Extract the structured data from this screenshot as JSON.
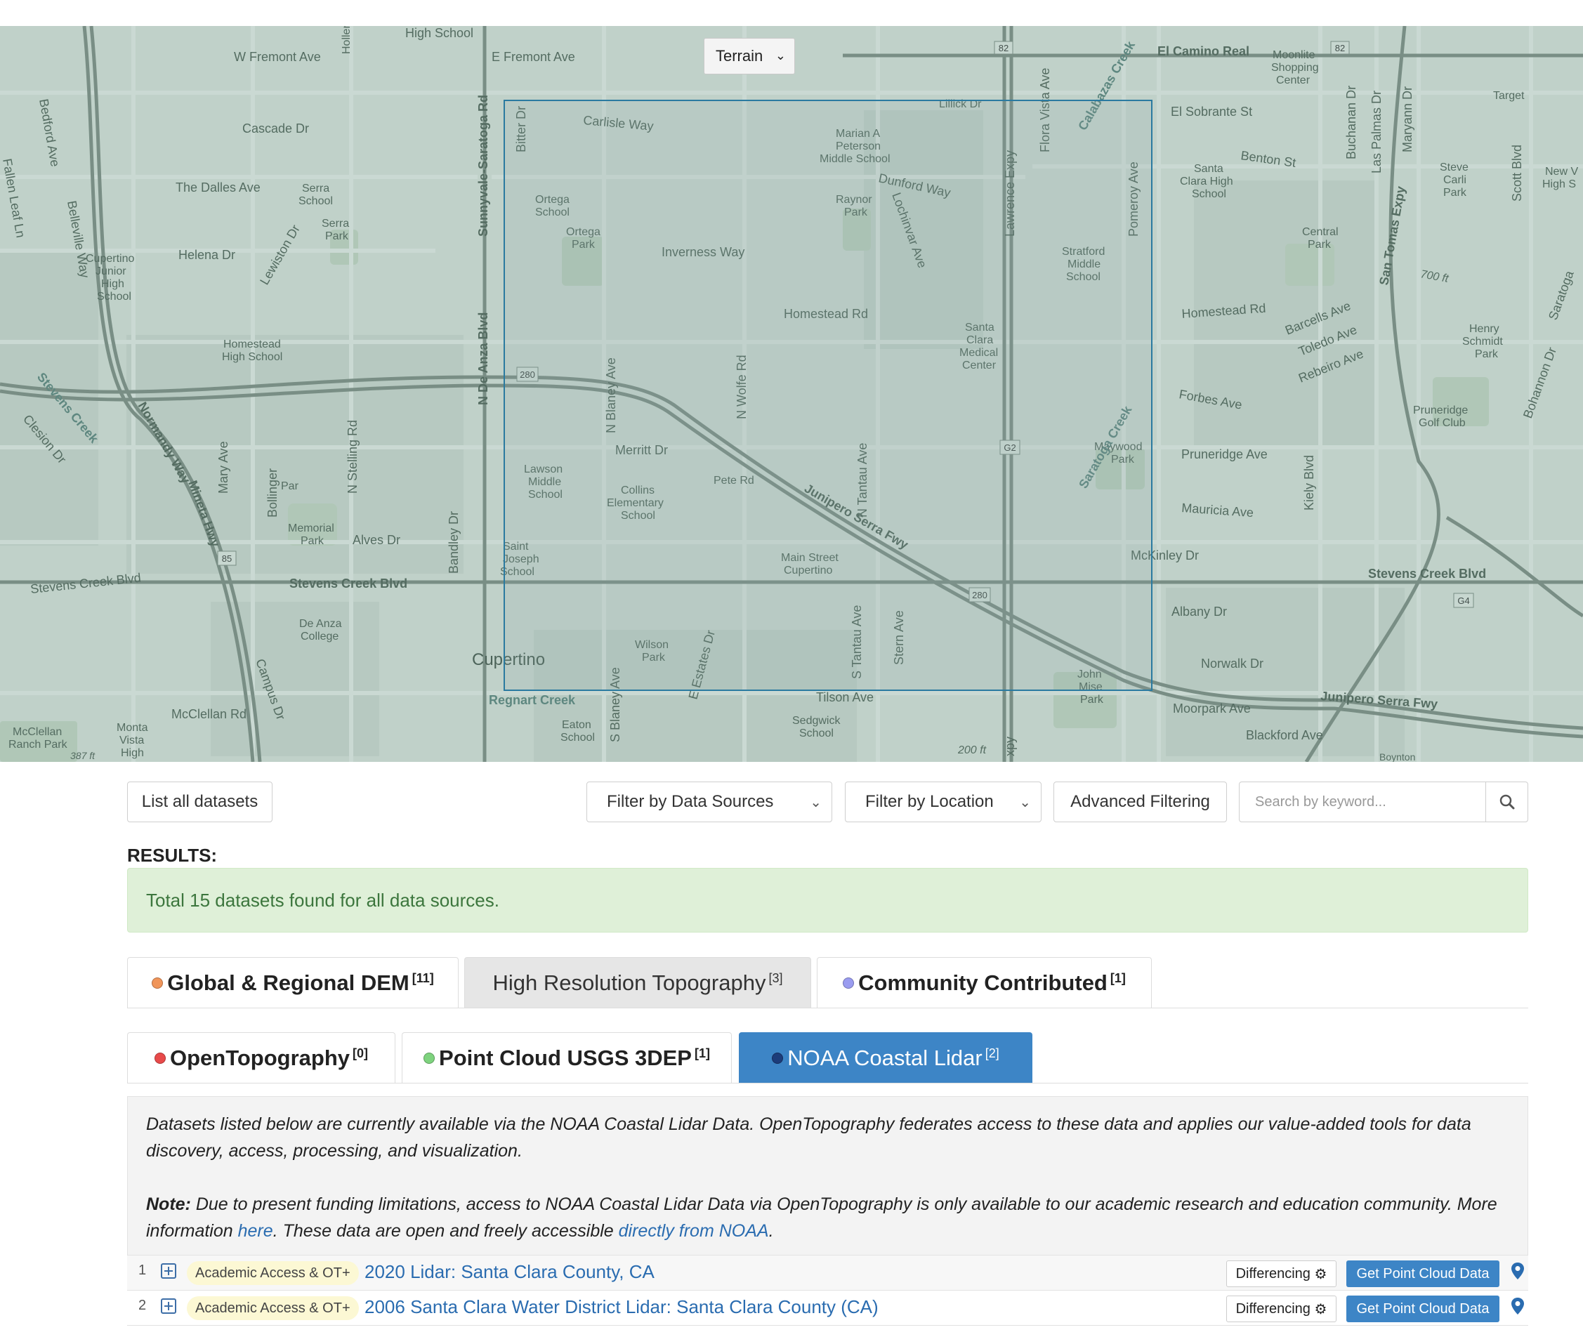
{
  "map": {
    "terrain_select": "Terrain",
    "labels": {
      "w_fremont": "W Fremont Ave",
      "high_school": "High School",
      "e_fremont": "E Fremont Ave",
      "el_camino": "El Camino Real",
      "moonlite": "Moonlite",
      "shopping": "Shopping",
      "center": "Center",
      "target": "Target",
      "cascade": "Cascade Dr",
      "carlisle": "Carlisle Way",
      "marian": "Marian A",
      "peterson": "Peterson",
      "middle_school": "Middle School",
      "el_sobrante": "El Sobrante St",
      "benton": "Benton St",
      "the_dalles": "The Dalles Ave",
      "serra_school": "Serra",
      "serra_school2": "School",
      "serra_park": "Serra",
      "serra_park2": "Park",
      "ortega_school": "Ortega",
      "ortega_school2": "School",
      "ortega_park": "Ortega",
      "ortega_park2": "Park",
      "dunford": "Dunford Way",
      "raynor": "Raynor",
      "raynor2": "Park",
      "santa_clara_hs": "Santa",
      "santa_clara_hs2": "Clara High",
      "santa_clara_hs3": "School",
      "steve_carli": "Steve",
      "steve_carli2": "Carli",
      "steve_carli3": "Park",
      "new_v": "New V",
      "high_s": "High S",
      "helena": "Helena Dr",
      "inverness": "Inverness Way",
      "stratford": "Stratford",
      "stratford2": "Middle",
      "stratford3": "School",
      "central_park": "Central",
      "central_park2": "Park",
      "cupertino_jr": "Cupertino",
      "cupertino_jr2": "Junior",
      "cupertino_jr3": "High",
      "cupertino_jr4": "School",
      "homestead_rd": "Homestead Rd",
      "homestead_rd2": "Homestead Rd",
      "homestead_hs": "Homestead",
      "homestead_hs2": "High School",
      "santa_clara_mc": "Santa",
      "santa_clara_mc2": "Clara",
      "santa_clara_mc3": "Medical",
      "santa_clara_mc4": "Center",
      "barcells": "Barcells Ave",
      "toledo": "Toledo Ave",
      "rebeiro": "Rebeiro Ave",
      "henry": "Henry",
      "henry2": "Schmidt",
      "henry3": "Park",
      "forbes": "Forbes Ave",
      "pruneridge_gc": "Pruneridge",
      "pruneridge_gc2": "Golf Club",
      "merritt": "Merritt Dr",
      "pruneridge_ave": "Pruneridge Ave",
      "lawson": "Lawson",
      "lawson2": "Middle",
      "lawson3": "School",
      "collins": "Collins",
      "collins2": "Elementary",
      "collins3": "School",
      "maywood": "Maywood",
      "maywood2": "Park",
      "mauricia": "Mauricia Ave",
      "memorial": "Memorial",
      "memorial2": "Park",
      "alves": "Alves Dr",
      "junipero": "Junipero Serra Fwy",
      "mckinley": "McKinley Dr",
      "stevens_creek_blvd": "Stevens Creek Blvd",
      "stevens_creek_blvd2": "Stevens Creek Blvd",
      "stevens_creek_blvd3": "Stevens Creek Blvd",
      "saint_joseph": "Saint",
      "saint_joseph2": "Joseph",
      "saint_joseph3": "School",
      "main_street": "Main Street",
      "main_street2": "Cupertino",
      "albany": "Albany Dr",
      "de_anza": "De Anza",
      "de_anza2": "College",
      "cupertino": "Cupertino",
      "wilson": "Wilson",
      "wilson2": "Park",
      "norwalk": "Norwalk Dr",
      "junipero2": "Junipero Serra Fwy",
      "regnart": "Regnart Creek",
      "tilson": "Tilson Ave",
      "john_mise": "John",
      "john_mise2": "Mise",
      "john_mise3": "Park",
      "moorpark": "Moorpark Ave",
      "mcclellan": "McClellan Rd",
      "eaton": "Eaton",
      "eaton2": "School",
      "sedgwick": "Sedgwick",
      "sedgwick2": "School",
      "blackford": "Blackford Ave",
      "mcclellan_ranch": "McClellan",
      "mcclellan_ranch2": "Ranch Park",
      "monta_vista": "Monta",
      "monta_vista2": "Vista",
      "monta_vista3": "High",
      "ft200": "200 ft",
      "ft700": "700 ft",
      "bedford": "Bedford Ave",
      "belleville": "Belleville Way",
      "hollenbeck": "Hollenbeck",
      "sunnyvale_saratoga": "Sunnyvale-Saratoga Rd",
      "n_de_anza": "N De Anza Blvd",
      "bitter": "Bitter Dr",
      "n_blaney": "N Blaney Ave",
      "n_wolfe": "N Wolfe Rd",
      "lochinvar": "Lochinvar Ave",
      "lawrence": "Lawrence Expy",
      "flora_vista": "Flora Vista Ave",
      "calabazas": "Calabazas Creek",
      "pomeroy": "Pomeroy Ave",
      "buchanan": "Buchanan Dr",
      "las_palmas": "Las Palmas Dr",
      "maryann": "Maryann Dr",
      "san_tomas": "San Tomas Expy",
      "scott": "Scott Blvd",
      "lewiston": "Lewiston Dr",
      "n_stelling": "N Stelling Rd",
      "mary": "Mary Ave",
      "n_tantau": "N Tantau Ave",
      "kiely": "Kiely Blvd",
      "saratoga_creek": "Saratoga Creek",
      "stevens_creek": "Stevens Creek",
      "clesion": "Clesion Dr",
      "norman": "Normandy Way",
      "bandley": "Bandley Dr",
      "s_tantau": "S Tantau Ave",
      "stern": "Stern Ave",
      "s_blaney": "S Blaney Ave",
      "e_estates": "E Estates Dr",
      "campus": "Campus Dr",
      "bohannon": "Bohannon Dr",
      "saratoga": "Saratoga",
      "boynton": "Boynton",
      "lillick": "Lillick Dr",
      "parcel": "Par",
      "peter": "Pete Rd",
      "minetta": "Mineta Hwy",
      "bollinger": "Bollinger",
      "fallen_leaf": "Fallen Leaf Ln",
      "shield_82a": "82",
      "shield_82b": "82",
      "shield_280a": "280",
      "shield_280b": "280",
      "shield_85": "85",
      "shield_g2": "G2",
      "shield_g4": "G4",
      "exp_label": "xpy",
      "ft387": "387 ft"
    }
  },
  "toolbar": {
    "list_all": "List all datasets",
    "filter_sources": "Filter by Data Sources",
    "filter_location": "Filter by Location",
    "advanced": "Advanced Filtering",
    "search_placeholder": "Search by keyword..."
  },
  "results": {
    "label": "RESULTS:",
    "summary": "Total 15 datasets found for all data sources."
  },
  "tabs_main": [
    {
      "label": "Global & Regional DEM",
      "count": "[11]",
      "dot": "#f0955a"
    },
    {
      "label": "High Resolution Topography",
      "count": "[3]"
    },
    {
      "label": "Community Contributed",
      "count": "[1]",
      "dot": "#9a9cf0"
    }
  ],
  "tabs_sub": [
    {
      "label": "OpenTopography",
      "count": "[0]",
      "dot": "#e84a4a"
    },
    {
      "label": "Point Cloud USGS 3DEP",
      "count": "[1]",
      "dot": "#7ed37e"
    },
    {
      "label": "NOAA Coastal Lidar",
      "count": "[2]",
      "dot": "#1c3c7a"
    }
  ],
  "info": {
    "p1": "Datasets listed below are currently available via the NOAA Coastal Lidar Data. OpenTopography federates access to these data and applies our value-added tools for data discovery, access, processing, and visualization.",
    "note_label": "Note:",
    "p2a": " Due to present funding limitations, access to NOAA Coastal Lidar Data via OpenTopography is only available to our academic research and education community. More information ",
    "here": "here",
    "p2b": ". These data are open and freely accessible ",
    "noaa_link": "directly from NOAA",
    "p2c": "."
  },
  "datasets": [
    {
      "num": "1",
      "badge": "Academic Access & OT+",
      "title": "2020 Lidar: Santa Clara County, CA",
      "diff": "Differencing",
      "action": "Get Point Cloud Data"
    },
    {
      "num": "2",
      "badge": "Academic Access & OT+",
      "title": "2006 Santa Clara Water District Lidar: Santa Clara County (CA)",
      "diff": "Differencing",
      "action": "Get Point Cloud Data"
    }
  ],
  "colors": {
    "accent_blue": "#3d85c6",
    "link_blue": "#2a6cb0",
    "success_bg": "#dff0d8",
    "success_text": "#3c763d",
    "badge_bg": "#fcf8d4"
  }
}
